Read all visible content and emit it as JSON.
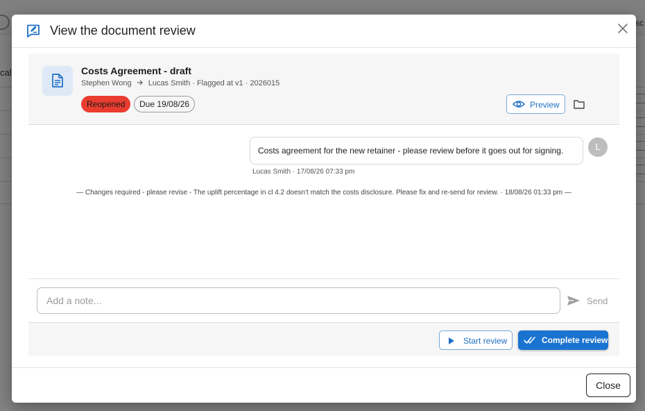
{
  "background": {
    "left_text": "cal",
    "right_text": "sc"
  },
  "dialog": {
    "title": "View the document review",
    "close_label": "Close"
  },
  "document": {
    "title": "Costs Agreement - draft",
    "from": "Stephen Wong",
    "to": "Lucas Smith",
    "meta_tail": "· Flagged at v1 · 2026015",
    "status_badge": "Reopened",
    "due_badge": "Due 19/08/26",
    "preview_label": "Preview"
  },
  "thread": {
    "message": "Costs agreement for the new retainer - please review before it goes out for signing.",
    "avatar_initial": "L",
    "message_meta": "Lucas Smith · 17/08/26 07:33 pm",
    "system_note": "— Changes required - please revise - The uplift percentage in cl 4.2 doesn't match the costs disclosure. Please fix and re-send for review. · 18/08/26 01:33 pm —"
  },
  "compose": {
    "placeholder": "Add a note...",
    "value": "",
    "send_label": "Send"
  },
  "actions": {
    "start_label": "Start review",
    "complete_label": "Complete review"
  },
  "colors": {
    "accent": "#1a73d1",
    "reopened": "#ea3c2f",
    "avatar": "#bdbdbd"
  }
}
